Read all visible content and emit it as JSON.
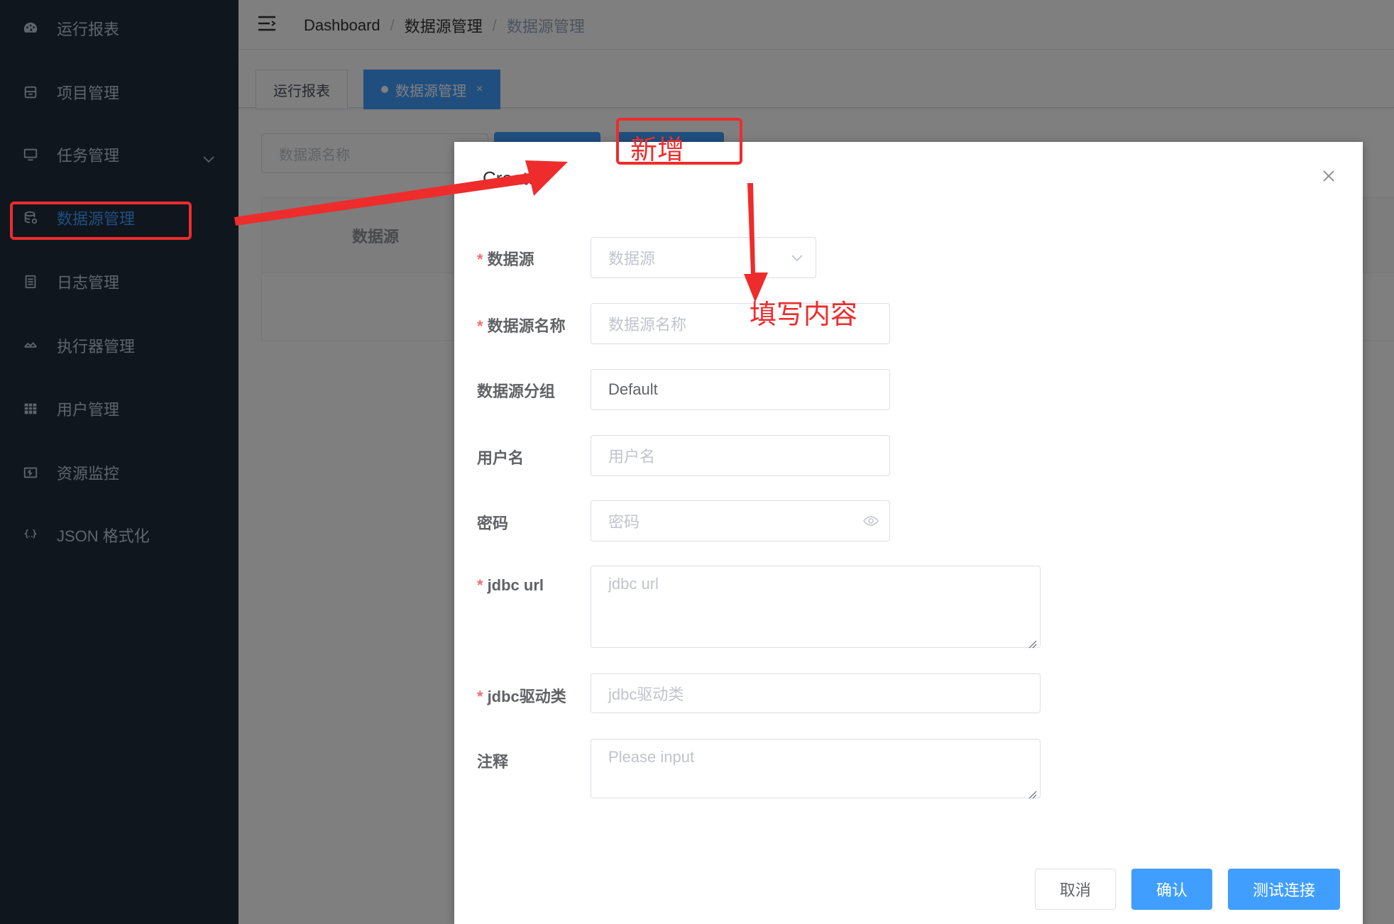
{
  "sidebar": {
    "items": [
      {
        "label": "运行报表",
        "icon": "dashboard-icon"
      },
      {
        "label": "项目管理",
        "icon": "project-icon"
      },
      {
        "label": "任务管理",
        "icon": "monitor-icon"
      },
      {
        "label": "数据源管理",
        "icon": "database-icon"
      },
      {
        "label": "日志管理",
        "icon": "document-icon"
      },
      {
        "label": "执行器管理",
        "icon": "cloud-icon"
      },
      {
        "label": "用户管理",
        "icon": "table-icon"
      },
      {
        "label": "资源监控",
        "icon": "monitor-resource-icon"
      },
      {
        "label": "JSON 格式化",
        "icon": "braces-icon"
      }
    ]
  },
  "header": {
    "breadcrumb": [
      "Dashboard",
      "数据源管理",
      "数据源管理"
    ]
  },
  "tags": [
    {
      "label": "运行报表"
    },
    {
      "label": "数据源管理",
      "close": "×"
    }
  ],
  "filter": {
    "placeholder": "数据源名称"
  },
  "table": {
    "columns": [
      "数据源"
    ]
  },
  "dialog": {
    "title": "Create",
    "fields": {
      "datasource": {
        "label": "数据源",
        "placeholder": "数据源",
        "required": true
      },
      "name": {
        "label": "数据源名称",
        "placeholder": "数据源名称",
        "required": true
      },
      "group": {
        "label": "数据源分组",
        "value": "Default"
      },
      "username": {
        "label": "用户名",
        "placeholder": "用户名"
      },
      "password": {
        "label": "密码",
        "placeholder": "密码"
      },
      "jdbc_url": {
        "label": "jdbc url",
        "placeholder": "jdbc url",
        "required": true
      },
      "jdbc_driver": {
        "label": "jdbc驱动类",
        "placeholder": "jdbc驱动类",
        "required": true
      },
      "comment": {
        "label": "注释",
        "placeholder": "Please input"
      }
    },
    "buttons": {
      "cancel": "取消",
      "confirm": "确认",
      "test": "测试连接"
    },
    "required_mark": "*"
  },
  "annotations": {
    "add": "新增",
    "fill": "填写内容",
    "color": "#ee2c2c"
  },
  "colors": {
    "sidebar_bg": "#1f2d3d",
    "primary": "#409eff",
    "danger": "#f56c6c"
  }
}
